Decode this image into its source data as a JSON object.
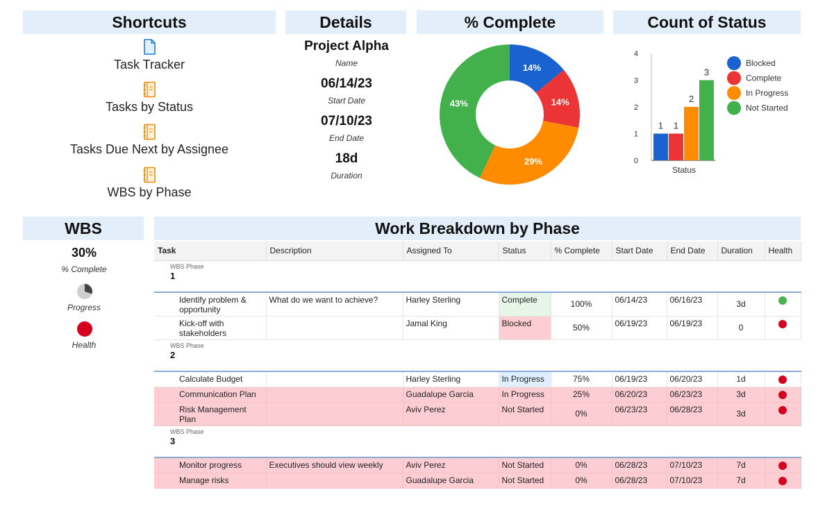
{
  "headers": {
    "shortcuts": "Shortcuts",
    "details": "Details",
    "complete": "% Complete",
    "count": "Count of Status",
    "wbs": "WBS",
    "breakdown": "Work Breakdown by Phase"
  },
  "shortcuts": [
    {
      "label": "Task Tracker",
      "icon": "document-icon"
    },
    {
      "label": "Tasks by Status",
      "icon": "notebook-icon"
    },
    {
      "label": "Tasks Due Next by Assignee",
      "icon": "notebook-icon"
    },
    {
      "label": "WBS by Phase",
      "icon": "notebook-icon"
    }
  ],
  "details": {
    "name": "Project Alpha",
    "name_label": "Name",
    "start": "06/14/23",
    "start_label": "Start Date",
    "end": "07/10/23",
    "end_label": "End Date",
    "duration": "18d",
    "duration_label": "Duration"
  },
  "wbs_summary": {
    "percent": "30%",
    "percent_label": "% Complete",
    "progress_label": "Progress",
    "health_label": "Health",
    "progress_fraction": 0.3
  },
  "colors": {
    "blocked": "#1a62d0",
    "complete": "#ea3435",
    "in_progress": "#ff8c00",
    "not_started": "#43b14b",
    "header_bg": "#e2effb",
    "health_green": "#4caf50",
    "health_red": "#d50020"
  },
  "chart_data": [
    {
      "type": "pie",
      "title": "% Complete",
      "slices": [
        {
          "name": "Blocked",
          "value": 14,
          "label": "14%",
          "color": "#1a62d0"
        },
        {
          "name": "Complete",
          "value": 14,
          "label": "14%",
          "color": "#ea3435"
        },
        {
          "name": "In Progress",
          "value": 29,
          "label": "29%",
          "color": "#ff8c00"
        },
        {
          "name": "Not Started",
          "value": 43,
          "label": "43%",
          "color": "#43b14b"
        }
      ]
    },
    {
      "type": "bar",
      "title": "Count of Status",
      "categories": [
        "Status"
      ],
      "xlabel": "Status",
      "ylim": [
        0,
        4
      ],
      "yticks": [
        "0",
        "1",
        "2",
        "3",
        "4"
      ],
      "series": [
        {
          "name": "Blocked",
          "values": [
            1
          ],
          "color": "#1a62d0"
        },
        {
          "name": "Complete",
          "values": [
            1
          ],
          "color": "#ea3435"
        },
        {
          "name": "In Progress",
          "values": [
            2
          ],
          "color": "#ff8c00"
        },
        {
          "name": "Not Started",
          "values": [
            3
          ],
          "color": "#43b14b"
        }
      ],
      "legend": "right"
    }
  ],
  "table": {
    "columns": [
      "Task",
      "Description",
      "Assigned To",
      "Status",
      "% Complete",
      "Start Date",
      "End Date",
      "Duration",
      "Health"
    ],
    "phase_label": "WBS Phase",
    "phases": [
      {
        "number": "1",
        "rows": [
          {
            "task": "Identify problem & opportunity",
            "description": "What do we want to achieve?",
            "assigned": "Harley Sterling",
            "status": "Complete",
            "pct": "100%",
            "start": "06/14/23",
            "end": "06/16/23",
            "duration": "3d",
            "health": "green"
          },
          {
            "task": "Kick-off with stakeholders",
            "description": "",
            "assigned": "Jamal King",
            "status": "Blocked",
            "pct": "50%",
            "start": "06/19/23",
            "end": "06/19/23",
            "duration": "0",
            "health": "red"
          }
        ]
      },
      {
        "number": "2",
        "rows": [
          {
            "task": "Calculate Budget",
            "description": "",
            "assigned": "Harley Sterling",
            "status": "In Progress",
            "pct": "75%",
            "start": "06/19/23",
            "end": "06/20/23",
            "duration": "1d",
            "health": "red"
          },
          {
            "task": "Communication Plan",
            "description": "",
            "assigned": "Guadalupe Garcia",
            "status": "In Progress",
            "pct": "25%",
            "start": "06/20/23",
            "end": "06/23/23",
            "duration": "3d",
            "health": "red"
          },
          {
            "task": "Risk Management Plan",
            "description": "",
            "assigned": "Aviv Perez",
            "status": "Not Started",
            "pct": "0%",
            "start": "06/23/23",
            "end": "06/28/23",
            "duration": "3d",
            "health": "red"
          }
        ]
      },
      {
        "number": "3",
        "rows": [
          {
            "task": "Monitor progress",
            "description": "Executives should view weekly",
            "assigned": "Aviv Perez",
            "status": "Not Started",
            "pct": "0%",
            "start": "06/28/23",
            "end": "07/10/23",
            "duration": "7d",
            "health": "red"
          },
          {
            "task": "Manage risks",
            "description": "",
            "assigned": "Guadalupe Garcia",
            "status": "Not Started",
            "pct": "0%",
            "start": "06/28/23",
            "end": "07/10/23",
            "duration": "7d",
            "health": "red"
          }
        ]
      }
    ]
  }
}
